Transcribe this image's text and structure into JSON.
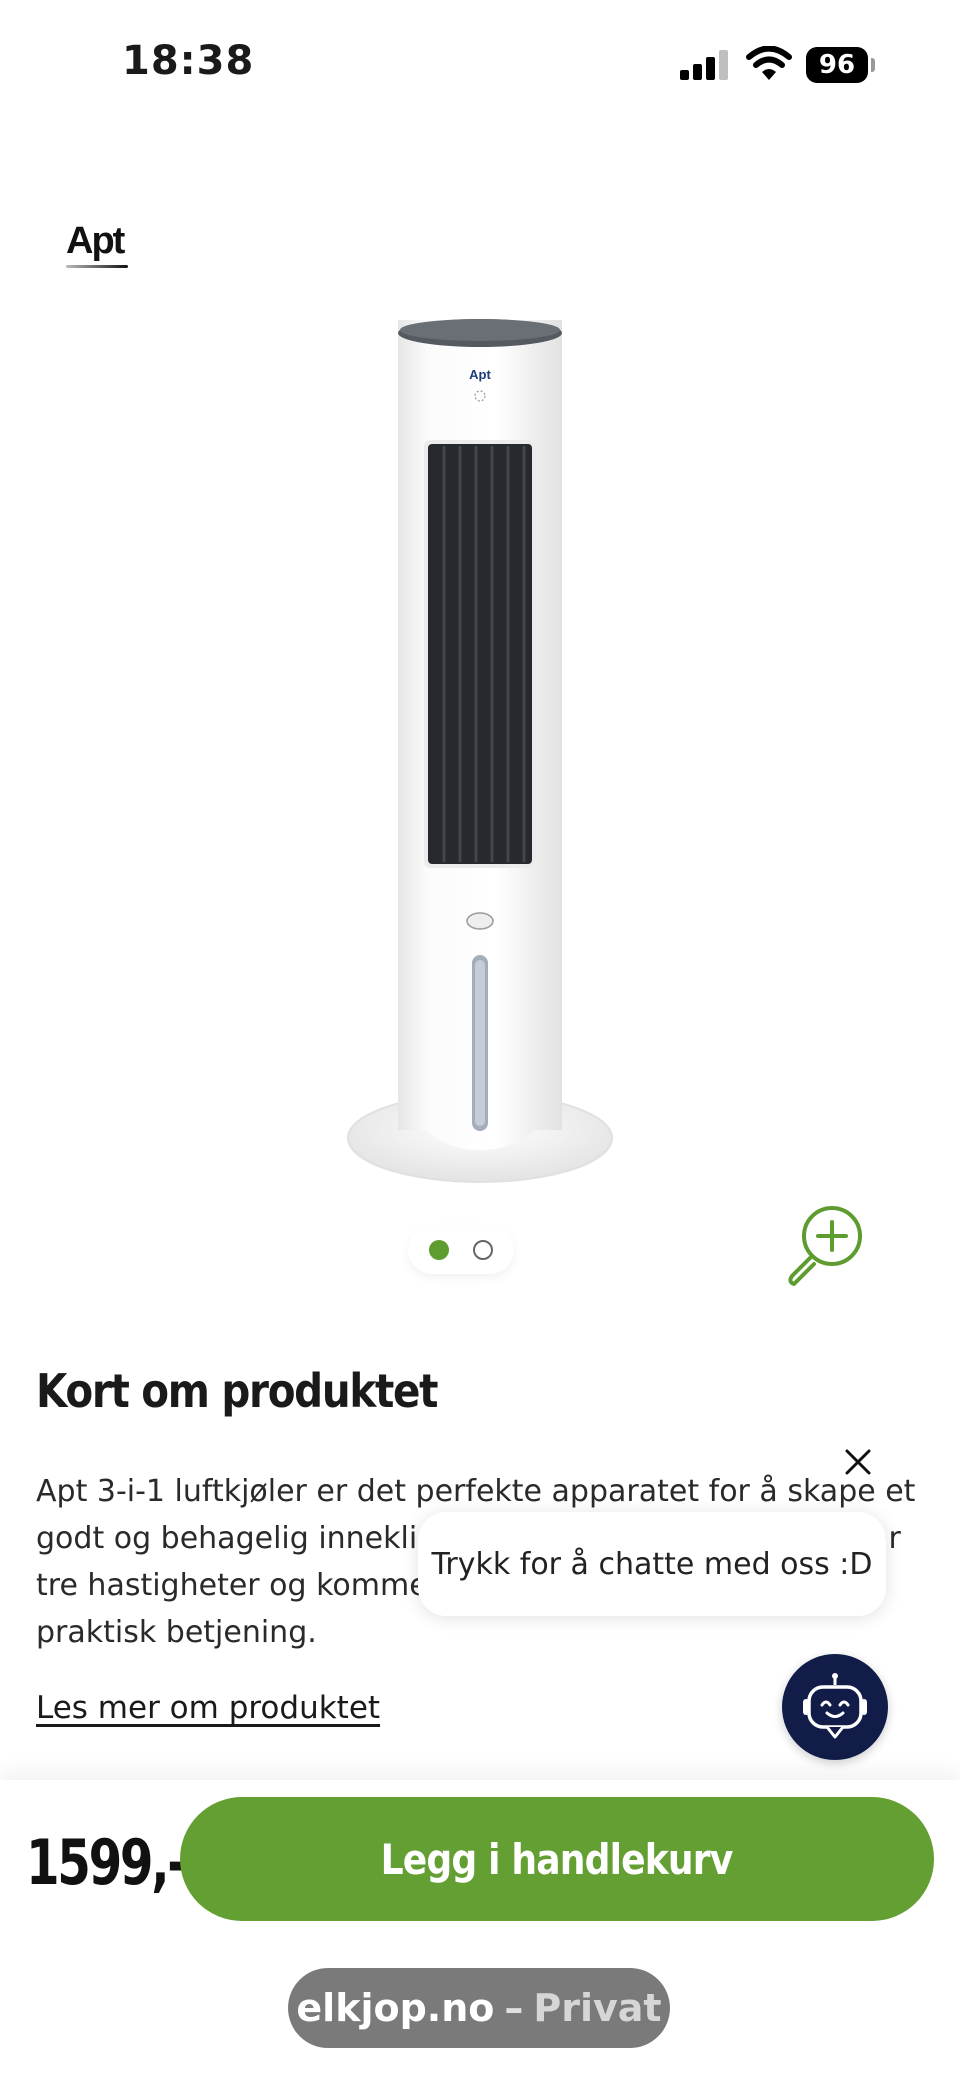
{
  "status_bar": {
    "time": "18:38",
    "battery": "96"
  },
  "brand": {
    "name": "Apt"
  },
  "product_image": {
    "device_logo": "Apt"
  },
  "carousel": {
    "total": 2,
    "active_index": 0
  },
  "product_info": {
    "title": "Kort om produktet",
    "description": "Apt 3-i-1 luftkjøler er det perfekte apparatet for å skape et godt og behagelig inneklima med luftfuktighet. Viften har tre hastigheter og kommer med en fjernkontroll for mer praktisk betjening.",
    "read_more": "Les mer om produktet"
  },
  "chat": {
    "tooltip": "Trykk for å chatte med oss :D"
  },
  "purchase": {
    "price": "1599,-",
    "button_label": "Legg i handlekurv"
  },
  "browser": {
    "domain": "elkjop.no",
    "separator": "–",
    "mode": "Privat"
  },
  "colors": {
    "accent_green": "#639f32",
    "chat_bot_navy": "#111d48"
  }
}
